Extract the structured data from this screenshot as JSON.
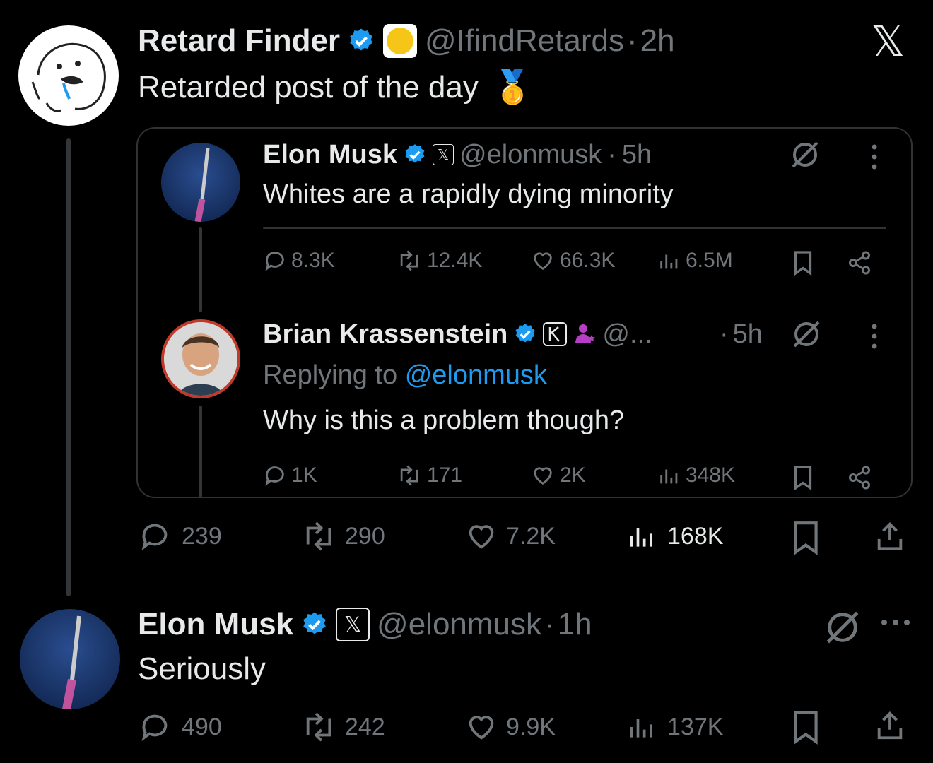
{
  "brand": {
    "x_logo": "𝕏"
  },
  "colors": {
    "accent": "#1d9bf0",
    "muted": "#71767b",
    "background": "#000000",
    "text": "#e7e9ea"
  },
  "post1": {
    "author_name": "Retard Finder",
    "handle": "@IfindRetards",
    "separator": "·",
    "time": "2h",
    "text": "Retarded post of the day",
    "emoji": "🥇",
    "actions": {
      "replies": "239",
      "reposts": "290",
      "likes": "7.2K",
      "views": "168K"
    }
  },
  "quote": {
    "tweet1": {
      "author_name": "Elon Musk",
      "handle": "@elonmusk",
      "separator": "·",
      "time": "5h",
      "text": "Whites are a rapidly dying minority",
      "actions": {
        "replies": "8.3K",
        "reposts": "12.4K",
        "likes": "66.3K",
        "views": "6.5M"
      }
    },
    "tweet2": {
      "author_name": "Brian Krassenstein",
      "handle": "@...",
      "separator": "·",
      "time": "5h",
      "replying_prefix": "Replying to",
      "replying_to": "@elonmusk",
      "text": "Why is this a problem though?",
      "actions": {
        "replies": "1K",
        "reposts": "171",
        "likes": "2K",
        "views": "348K"
      }
    }
  },
  "post2": {
    "author_name": "Elon Musk",
    "handle": "@elonmusk",
    "separator": "·",
    "time": "1h",
    "text": "Seriously",
    "actions": {
      "replies": "490",
      "reposts": "242",
      "likes": "9.9K",
      "views": "137K"
    }
  }
}
